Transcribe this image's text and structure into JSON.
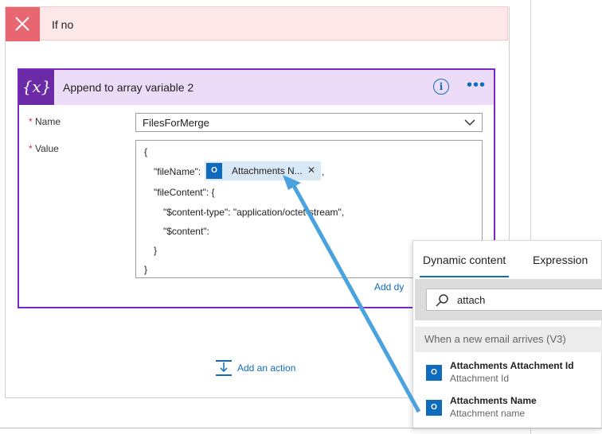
{
  "scope": {
    "title": "If no"
  },
  "action": {
    "title": "Append to array variable 2",
    "icon": "{x}",
    "name_label": "Name",
    "name_required": "*",
    "name_value": "FilesForMerge",
    "value_label": "Value",
    "value_required": "*",
    "lines": [
      "{",
      "\"fileName\":",
      ",",
      "\"fileContent\": {",
      "\"$content-type\": \"application/octet-stream\",",
      "\"$content\":",
      "}",
      "}"
    ],
    "token_text": "Attachments N...",
    "add_dynamic": "Add dy"
  },
  "add_action": "Add an action",
  "panel": {
    "tabs": [
      "Dynamic content",
      "Expression"
    ],
    "search_value": "attach",
    "section": "When a new email arrives (V3)",
    "items": [
      {
        "title": "Attachments Attachment Id",
        "subtitle": "Attachment Id"
      },
      {
        "title": "Attachments Name",
        "subtitle": "Attachment name"
      }
    ]
  },
  "colors": {
    "accent": "#0f6cbd",
    "variable_header": "#6b2ba7",
    "scope_header": "#fde7e9",
    "scope_icon": "#e8666f"
  }
}
